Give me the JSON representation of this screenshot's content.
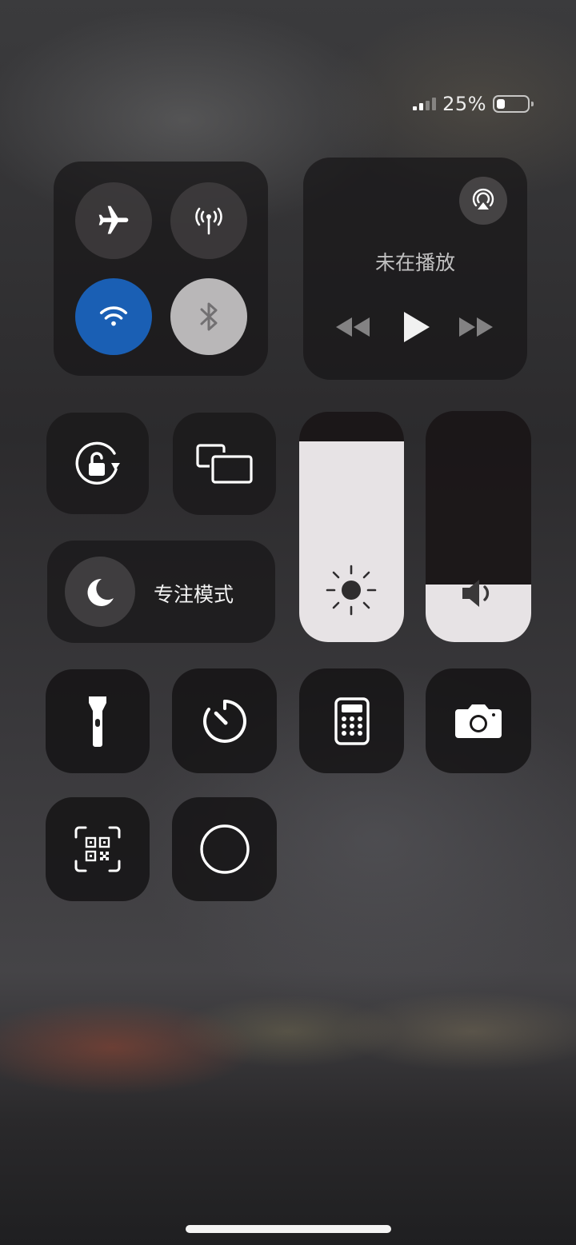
{
  "status_bar": {
    "signal_bars": 4,
    "signal_active": 2,
    "battery_percent_label": "25%",
    "battery_level": 0.25
  },
  "connectivity": {
    "airplane_mode": false,
    "cellular_data": false,
    "wifi": true,
    "bluetooth": false,
    "accent_color": "#1a5fb4"
  },
  "media": {
    "now_playing_label": "未在播放",
    "icons": [
      "airplay-icon",
      "previous-track-icon",
      "play-icon",
      "next-track-icon"
    ]
  },
  "controls": {
    "focus_label": "专注模式"
  },
  "sliders": {
    "brightness_level": 0.87,
    "volume_level": 0.25
  },
  "shortcuts": [
    "flashlight-icon",
    "timer-icon",
    "calculator-icon",
    "camera-icon",
    "qr-code-scanner-icon",
    "screen-recording-icon"
  ]
}
